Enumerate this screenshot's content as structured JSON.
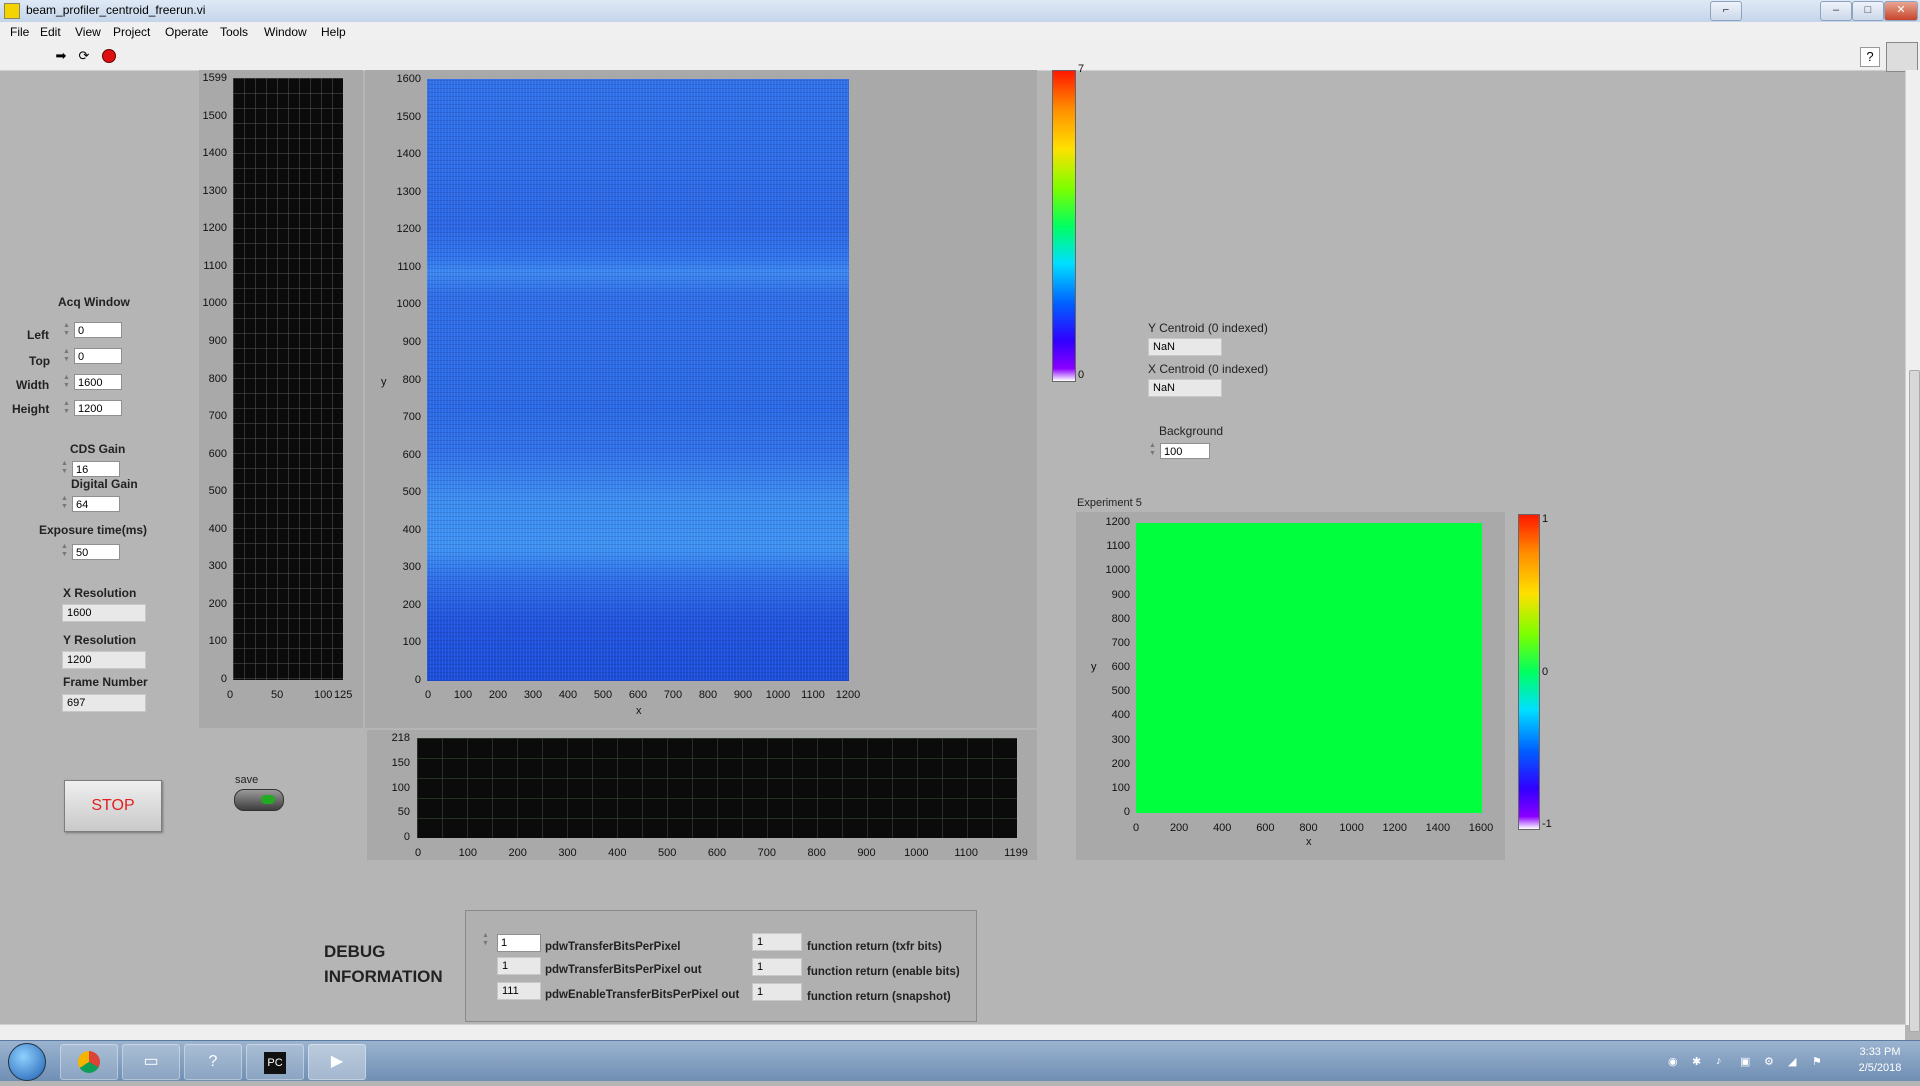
{
  "window": {
    "title": "beam_profiler_centroid_freerun.vi"
  },
  "menu": [
    "File",
    "Edit",
    "View",
    "Project",
    "Operate",
    "Tools",
    "Window",
    "Help"
  ],
  "acq_window": {
    "heading": "Acq Window",
    "left_label": "Left",
    "left_value": "0",
    "top_label": "Top",
    "top_value": "0",
    "width_label": "Width",
    "width_value": "1600",
    "height_label": "Height",
    "height_value": "1200"
  },
  "cds_gain": {
    "label": "CDS Gain",
    "value": "16"
  },
  "digital_gain": {
    "label": "Digital Gain",
    "value": "64"
  },
  "exposure": {
    "label": "Exposure time(ms)",
    "value": "50"
  },
  "x_resolution": {
    "label": "X Resolution",
    "value": "1600"
  },
  "y_resolution": {
    "label": "Y Resolution",
    "value": "1200"
  },
  "frame_number": {
    "label": "Frame Number",
    "value": "697"
  },
  "stop_button": {
    "label": "STOP"
  },
  "save_switch": {
    "label": "save"
  },
  "side_profile": {
    "y_ticks": [
      "1599",
      "1500",
      "1400",
      "1300",
      "1200",
      "1100",
      "1000",
      "900",
      "800",
      "700",
      "600",
      "500",
      "400",
      "300",
      "200",
      "100",
      "0"
    ],
    "x_ticks": [
      "0",
      "50",
      "100",
      "125"
    ]
  },
  "main_image": {
    "y_label": "y",
    "x_label": "x",
    "y_ticks": [
      "1600",
      "1500",
      "1400",
      "1300",
      "1200",
      "1100",
      "1000",
      "900",
      "800",
      "700",
      "600",
      "500",
      "400",
      "300",
      "200",
      "100",
      "0"
    ],
    "x_ticks": [
      "0",
      "100",
      "200",
      "300",
      "400",
      "500",
      "600",
      "700",
      "800",
      "900",
      "1000",
      "1100",
      "1200"
    ]
  },
  "bottom_profile": {
    "y_ticks": [
      "218",
      "150",
      "100",
      "50",
      "0"
    ],
    "x_ticks": [
      "0",
      "100",
      "200",
      "300",
      "400",
      "500",
      "600",
      "700",
      "800",
      "900",
      "1000",
      "1100",
      "1199"
    ]
  },
  "main_colorbar": {
    "top_tick": "7",
    "bottom_tick": "0"
  },
  "y_centroid": {
    "label": "Y Centroid (0 indexed)",
    "value": "NaN"
  },
  "x_centroid": {
    "label": "X Centroid (0 indexed)",
    "value": "NaN"
  },
  "background": {
    "label": "Background",
    "value": "100"
  },
  "experiment": {
    "label": "Experiment 5",
    "y_label": "y",
    "x_label": "x",
    "y_ticks": [
      "1200",
      "1100",
      "1000",
      "900",
      "800",
      "700",
      "600",
      "500",
      "400",
      "300",
      "200",
      "100",
      "0"
    ],
    "x_ticks": [
      "0",
      "200",
      "400",
      "600",
      "800",
      "1000",
      "1200",
      "1400",
      "1600"
    ],
    "fill_color": "#00ff3c",
    "colorbar_ticks": [
      "1",
      "0",
      "-1"
    ]
  },
  "debug": {
    "heading_line1": "DEBUG",
    "heading_line2": "INFORMATION",
    "rows": [
      {
        "value": "1",
        "label": "pdwTransferBitsPerPixel",
        "ret_value": "1",
        "ret_label": "function return (txfr bits)"
      },
      {
        "value": "1",
        "label": "pdwTransferBitsPerPixel out",
        "ret_value": "1",
        "ret_label": "function return (enable bits)"
      },
      {
        "value": "111",
        "label": "pdwEnableTransferBitsPerPixel out",
        "ret_value": "1",
        "ret_label": "function return (snapshot)"
      }
    ]
  },
  "taskbar": {
    "time": "3:33 PM",
    "date": "2/5/2018",
    "apps": [
      "windows-start-icon",
      "chrome-icon",
      "explorer-icon",
      "help-icon",
      "pycharm-icon",
      "labview-icon"
    ]
  },
  "colors": {
    "panel": "#b5b5b5",
    "plot_bg": "#0b0b0b",
    "image_blue": "#1f63e6",
    "stop_text": "#e02020"
  }
}
